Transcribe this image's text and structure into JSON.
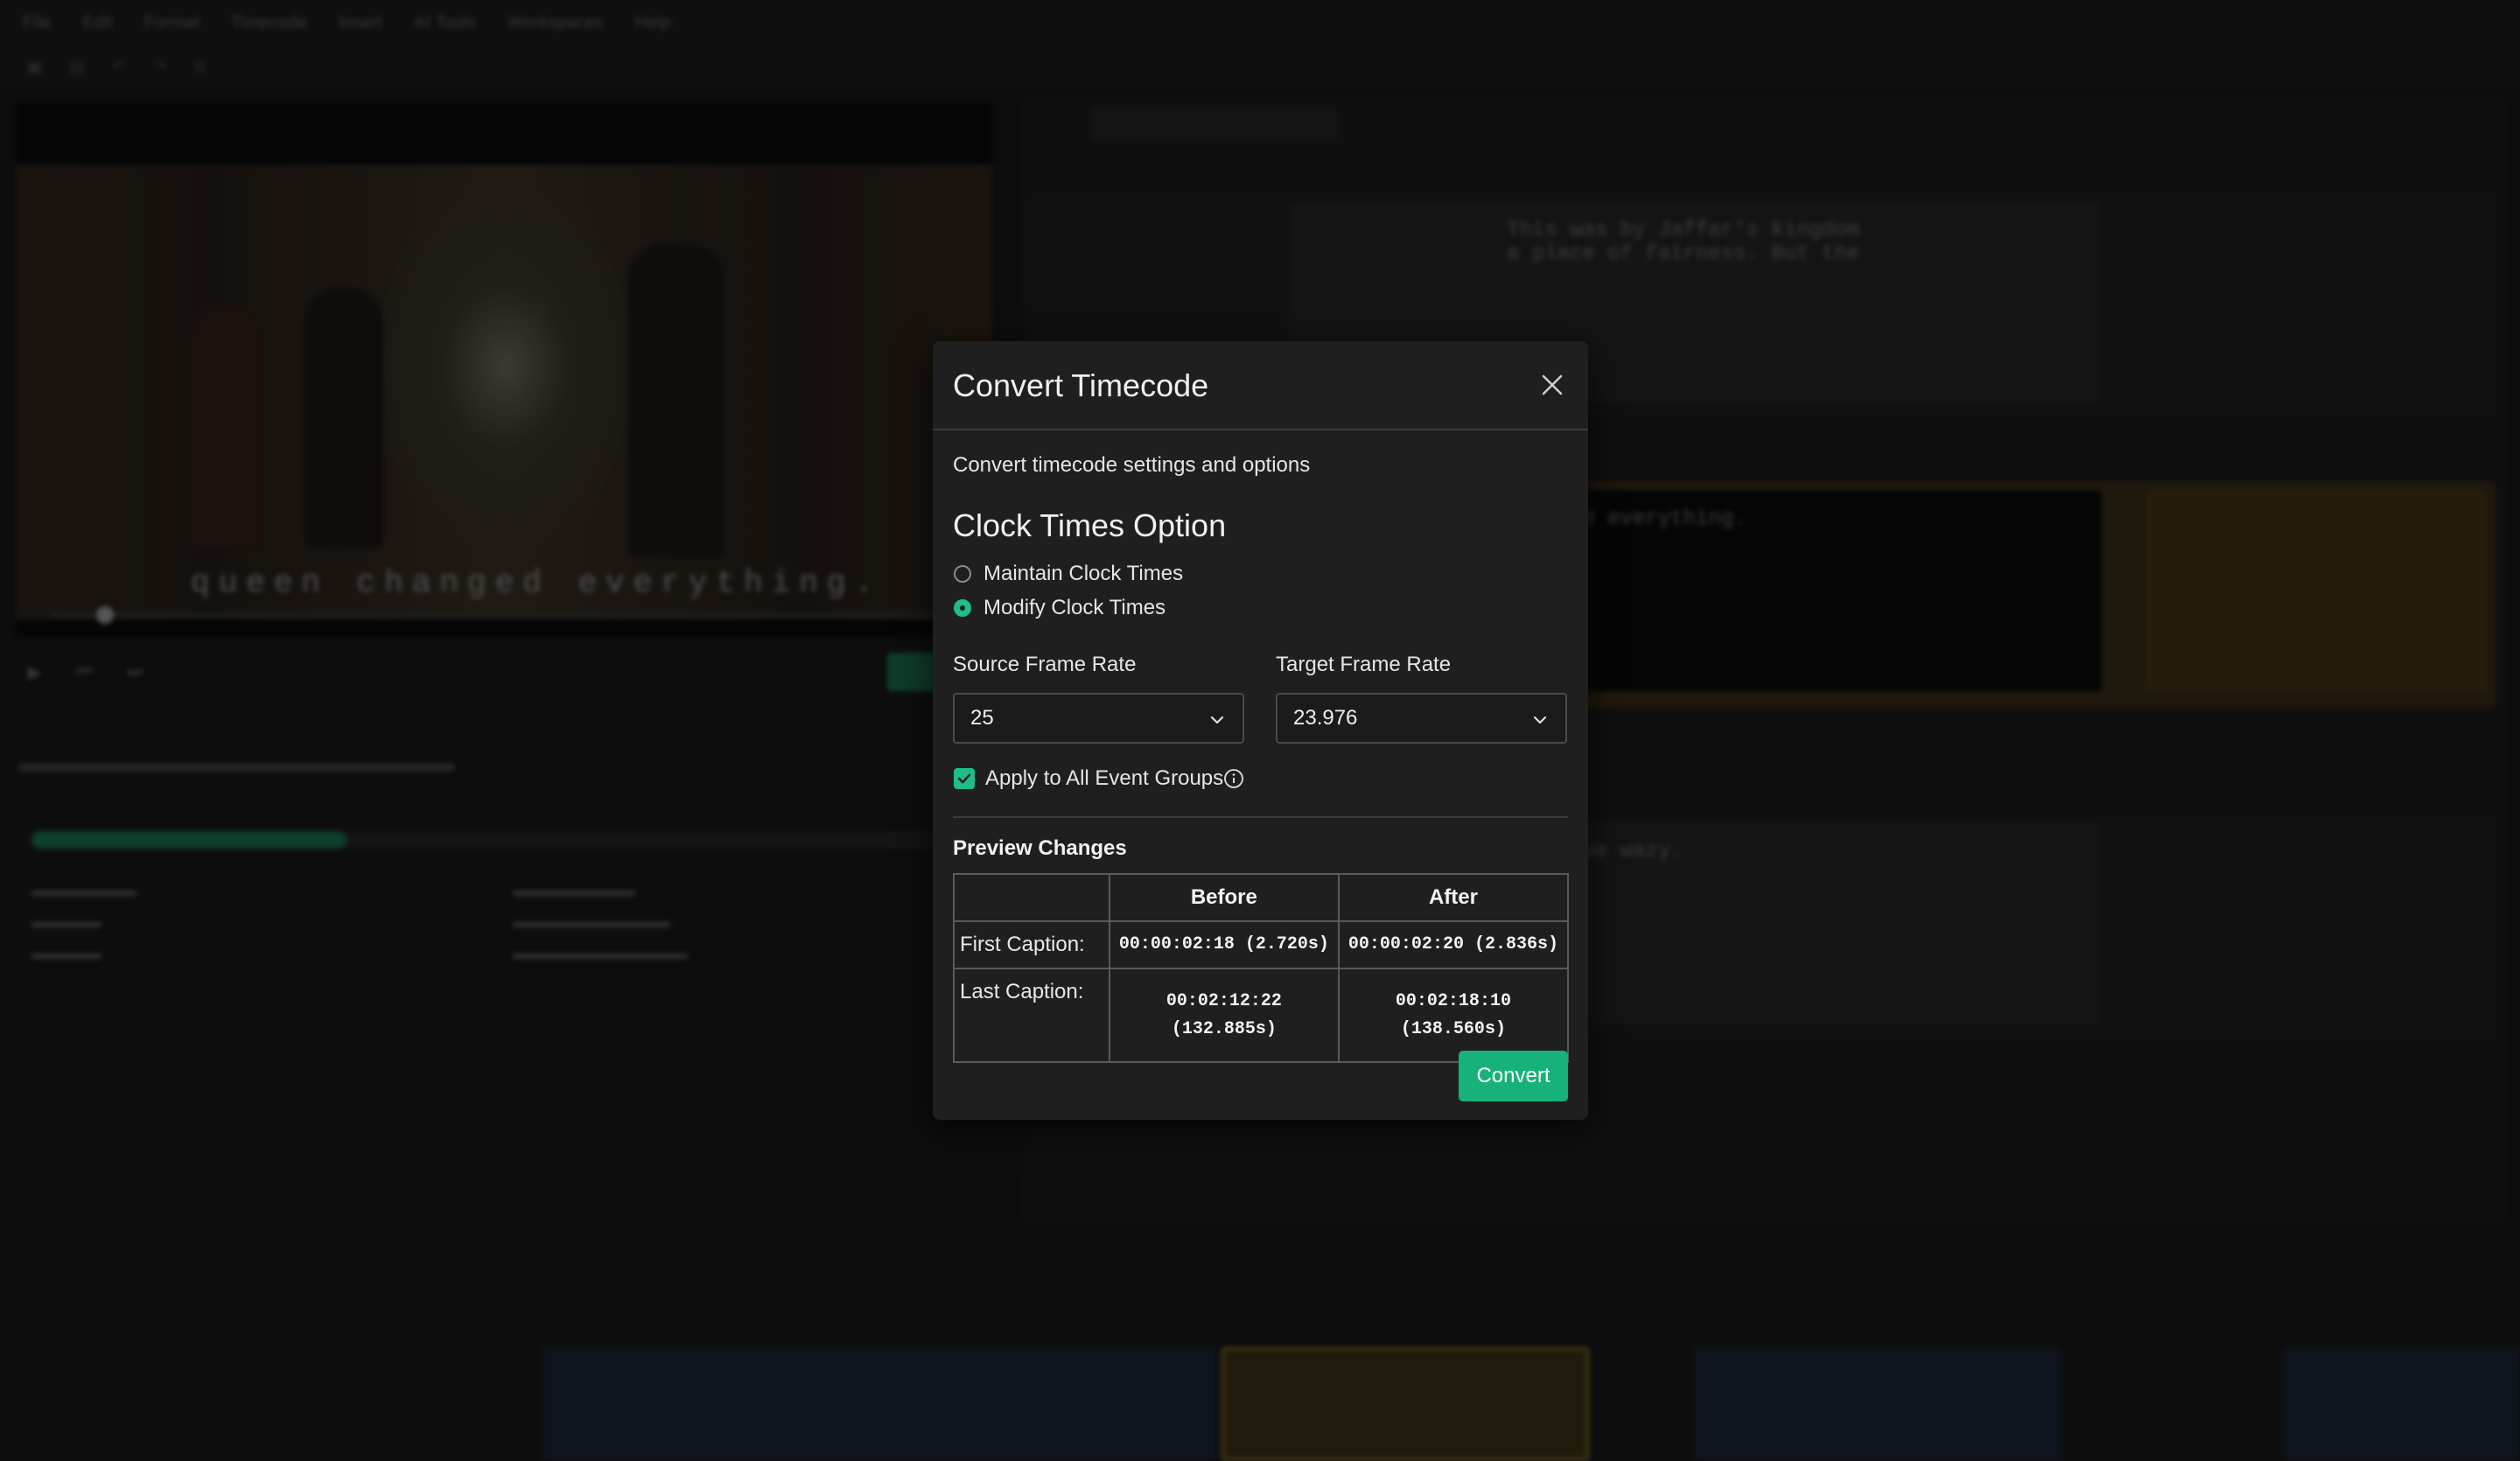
{
  "background": {
    "menu": [
      "File",
      "Edit",
      "Format",
      "Timecode",
      "Insert",
      "AI Tools",
      "Workspaces",
      "Help"
    ],
    "subtitle_overlay": "queen changed everything.",
    "editor_lines": [
      "This was by Jaffar's kingdom",
      "a place of fairness. But the"
    ],
    "editor_line2": "changed everything.",
    "editor_line3": "the true wazy."
  },
  "dialog": {
    "title": "Convert Timecode",
    "description": "Convert timecode settings and options",
    "section_title": "Clock Times Option",
    "options": [
      {
        "label": "Maintain Clock Times",
        "selected": false
      },
      {
        "label": "Modify Clock Times",
        "selected": true
      }
    ],
    "source_label": "Source Frame Rate",
    "source_value": "25",
    "target_label": "Target Frame Rate",
    "target_value": "23.976",
    "apply_all_label": "Apply to All Event Groups",
    "apply_all_checked": true,
    "preview_title": "Preview Changes",
    "table": {
      "headers": [
        "",
        "Before",
        "After"
      ],
      "rows": [
        {
          "label": "First Caption:",
          "before": "00:00:02:18 (2.720s)",
          "after": "00:00:02:20 (2.836s)"
        },
        {
          "label": "Last Caption:",
          "before_l1": "00:02:12:22",
          "before_l2": "(132.885s)",
          "after_l1": "00:02:18:10",
          "after_l2": "(138.560s)"
        }
      ]
    },
    "convert_label": "Convert",
    "accent": "#1ebe86"
  }
}
